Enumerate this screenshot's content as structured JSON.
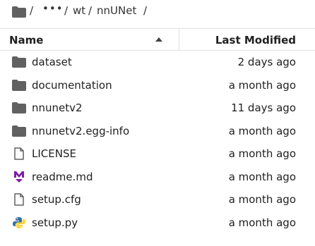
{
  "breadcrumb": {
    "root_sep": "/",
    "ellipsis": "•••",
    "ellipsis_sep": "/",
    "crumb1": "wt",
    "crumb1_sep": "/",
    "crumb2": "nnUNet",
    "crumb2_sep": "/"
  },
  "header": {
    "name_label": "Name",
    "modified_label": "Last Modified"
  },
  "files": [
    {
      "name": "dataset",
      "modified": "2 days ago",
      "icon": "folder-icon"
    },
    {
      "name": "documentation",
      "modified": "a month ago",
      "icon": "folder-icon"
    },
    {
      "name": "nnunetv2",
      "modified": "11 days ago",
      "icon": "folder-icon"
    },
    {
      "name": "nnunetv2.egg-info",
      "modified": "a month ago",
      "icon": "folder-icon"
    },
    {
      "name": "LICENSE",
      "modified": "a month ago",
      "icon": "file-icon"
    },
    {
      "name": "readme.md",
      "modified": "a month ago",
      "icon": "markdown-icon"
    },
    {
      "name": "setup.cfg",
      "modified": "a month ago",
      "icon": "file-icon"
    },
    {
      "name": "setup.py",
      "modified": "a month ago",
      "icon": "python-icon"
    }
  ],
  "colors": {
    "folder": "#616161",
    "markdown": "#7b1fa2",
    "python_blue": "#3572a5",
    "python_yellow": "#ffd43b",
    "border": "#e0e0e0"
  }
}
